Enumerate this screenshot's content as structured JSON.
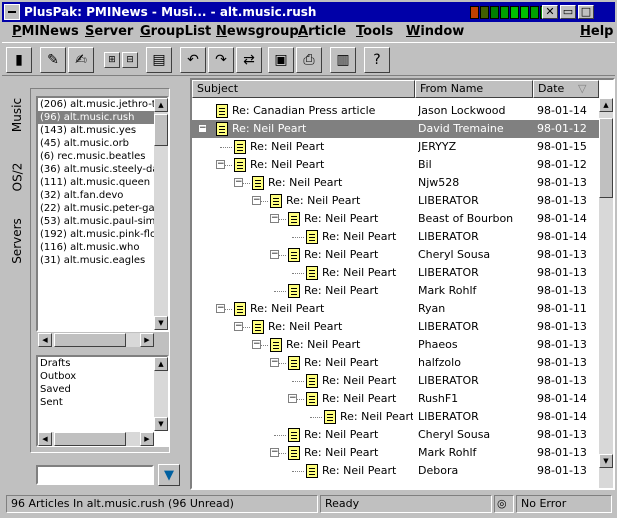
{
  "window": {
    "title": "PlusPak: PMINews - Musi... - alt.music.rush",
    "led_colors": [
      "#c04000",
      "#406000",
      "#008000",
      "#00a000",
      "#00c000",
      "#00c000",
      "#00a000",
      "#008000"
    ],
    "controls": {
      "close": "✕",
      "minimize": "▭",
      "maximize": "□"
    }
  },
  "menu": [
    "PMINews",
    "Server",
    "GroupList",
    "Newsgroup",
    "Article",
    "Tools",
    "Window",
    "Help"
  ],
  "toolbar_icons": [
    "exit-icon",
    "post-icon",
    "write-icon",
    "expand-all-icon",
    "collapse-all-icon",
    "new-article-icon",
    "reply-icon",
    "reply-all-icon",
    "forward-icon",
    "save-icon",
    "print-icon",
    "book-icon",
    "help-icon"
  ],
  "side_tabs": [
    "Music",
    "OS/2",
    "Servers"
  ],
  "groups": [
    {
      "label": "(206) alt.music.jethro-tul"
    },
    {
      "label": "(96) alt.music.rush",
      "selected": true
    },
    {
      "label": "(143) alt.music.yes"
    },
    {
      "label": "(45) alt.music.orb"
    },
    {
      "label": "(6) rec.music.beatles"
    },
    {
      "label": "(36) alt.music.steely-dar"
    },
    {
      "label": "(111) alt.music.queen"
    },
    {
      "label": "(32) alt.fan.devo"
    },
    {
      "label": "(22) alt.music.peter-gab"
    },
    {
      "label": "(53) alt.music.paul-simor"
    },
    {
      "label": "(192) alt.music.pink-floy"
    },
    {
      "label": "(116) alt.music.who"
    },
    {
      "label": "(31) alt.music.eagles"
    }
  ],
  "folders": [
    "Drafts",
    "Outbox",
    "Saved",
    "Sent"
  ],
  "search": {
    "value": ""
  },
  "columns": {
    "subject": "Subject",
    "from": "From Name",
    "date": "Date",
    "sort_arrow": "▽"
  },
  "articles": [
    {
      "level": 0,
      "subject": "Re: Canadian Press article",
      "from": "Jason Lockwood",
      "date": "98-01-14",
      "expander": ""
    },
    {
      "level": 0,
      "subject": "Re: Neil Peart",
      "from": "David Tremaine",
      "date": "98-01-12",
      "expander": "−",
      "selected": true
    },
    {
      "level": 1,
      "subject": "Re: Neil Peart",
      "from": "JERYYZ",
      "date": "98-01-15",
      "expander": ""
    },
    {
      "level": 1,
      "subject": "Re: Neil Peart",
      "from": "Bil",
      "date": "98-01-12",
      "expander": "−"
    },
    {
      "level": 2,
      "subject": "Re: Neil Peart",
      "from": "Njw528",
      "date": "98-01-13",
      "expander": "−"
    },
    {
      "level": 3,
      "subject": "Re: Neil Peart",
      "from": "LIBERATOR",
      "date": "98-01-13",
      "expander": "−"
    },
    {
      "level": 4,
      "subject": "Re: Neil Peart",
      "from": "Beast of Bourbon",
      "date": "98-01-14",
      "expander": "−"
    },
    {
      "level": 5,
      "subject": "Re: Neil Peart",
      "from": "LIBERATOR",
      "date": "98-01-14",
      "expander": ""
    },
    {
      "level": 4,
      "subject": "Re: Neil Peart",
      "from": "Cheryl Sousa",
      "date": "98-01-13",
      "expander": "−"
    },
    {
      "level": 5,
      "subject": "Re: Neil Peart",
      "from": "LIBERATOR",
      "date": "98-01-13",
      "expander": ""
    },
    {
      "level": 4,
      "subject": "Re: Neil Peart",
      "from": "Mark Rohlf",
      "date": "98-01-13",
      "expander": ""
    },
    {
      "level": 1,
      "subject": "Re: Neil Peart",
      "from": "Ryan",
      "date": "98-01-11",
      "expander": "−"
    },
    {
      "level": 2,
      "subject": "Re: Neil Peart",
      "from": "LIBERATOR",
      "date": "98-01-13",
      "expander": "−"
    },
    {
      "level": 3,
      "subject": "Re: Neil Peart",
      "from": "Phaeos",
      "date": "98-01-13",
      "expander": "−"
    },
    {
      "level": 4,
      "subject": "Re: Neil Peart",
      "from": "halfzolo",
      "date": "98-01-13",
      "expander": "−"
    },
    {
      "level": 5,
      "subject": "Re: Neil Peart",
      "from": "LIBERATOR",
      "date": "98-01-13",
      "expander": ""
    },
    {
      "level": 5,
      "subject": "Re: Neil Peart",
      "from": "RushF1",
      "date": "98-01-14",
      "expander": "−"
    },
    {
      "level": 6,
      "subject": "Re: Neil Peart",
      "from": "LIBERATOR",
      "date": "98-01-14",
      "expander": ""
    },
    {
      "level": 4,
      "subject": "Re: Neil Peart",
      "from": "Cheryl Sousa",
      "date": "98-01-13",
      "expander": ""
    },
    {
      "level": 4,
      "subject": "Re: Neil Peart",
      "from": "Mark Rohlf",
      "date": "98-01-13",
      "expander": "−"
    },
    {
      "level": 5,
      "subject": "Re: Neil Peart",
      "from": "Debora",
      "date": "98-01-13",
      "expander": ""
    }
  ],
  "status": {
    "articles": "96 Articles In alt.music.rush (96 Unread)",
    "state": "Ready",
    "error": "No Error"
  }
}
